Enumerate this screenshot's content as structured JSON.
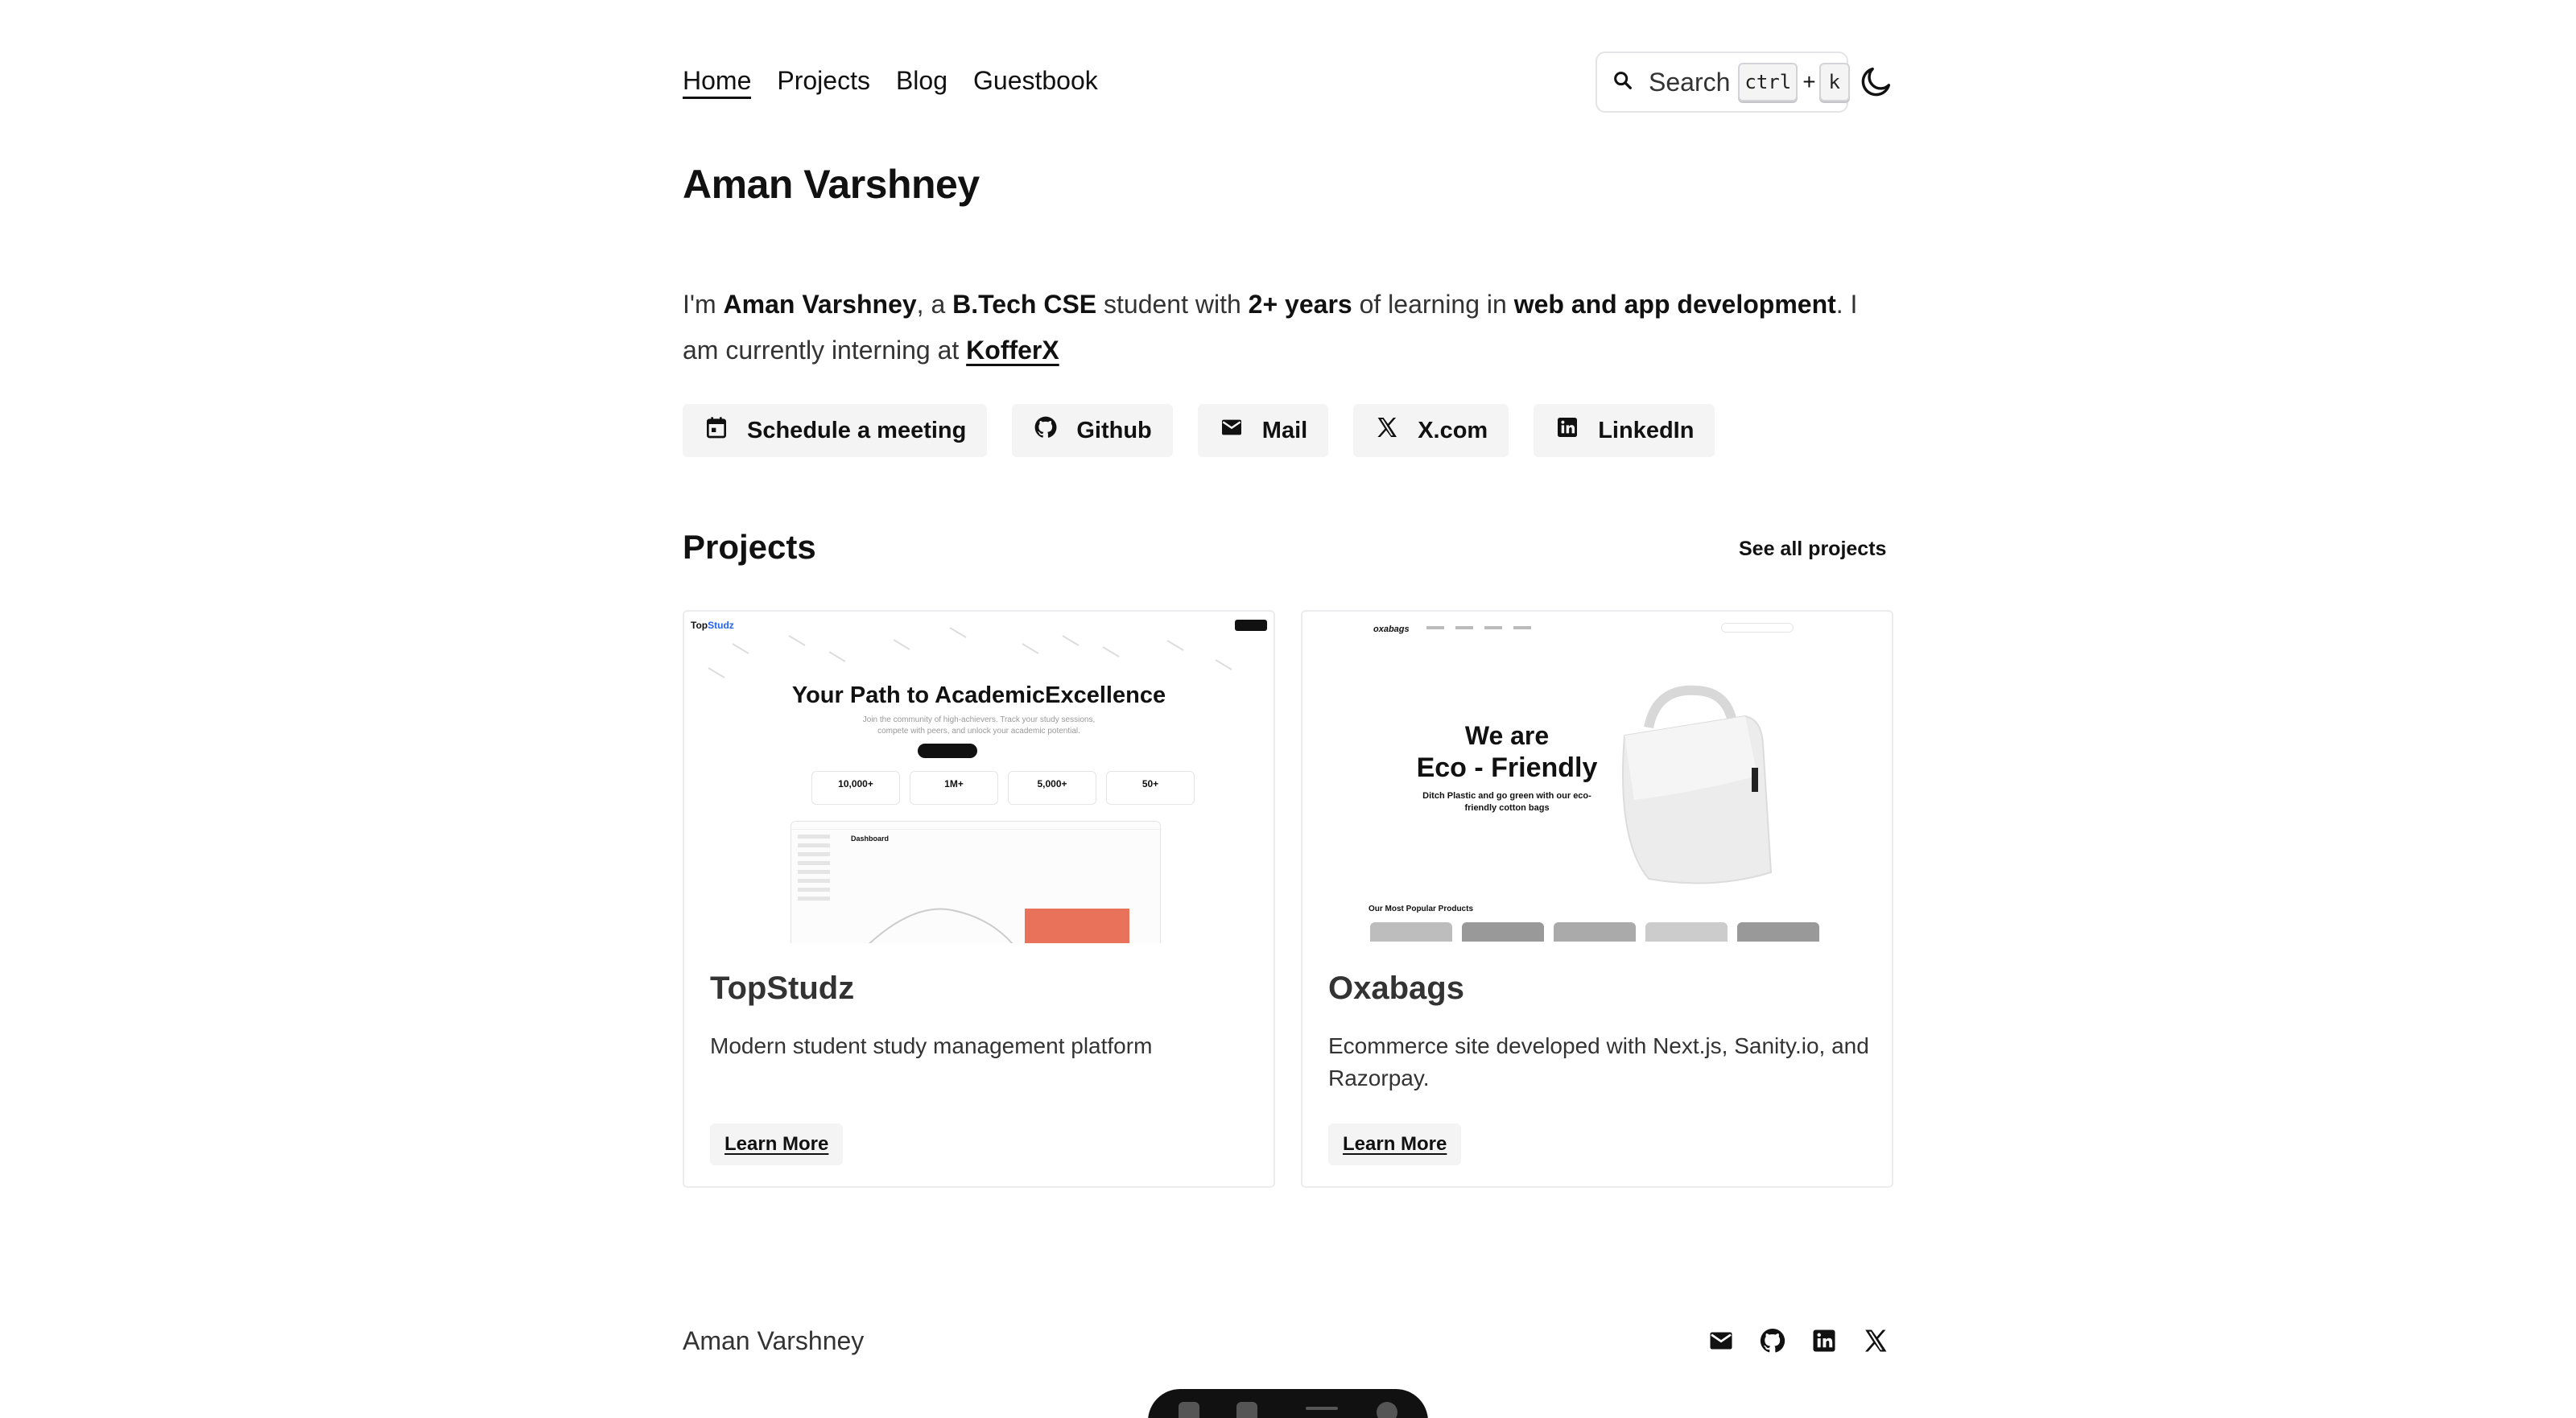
{
  "nav": {
    "links": [
      "Home",
      "Projects",
      "Blog",
      "Guestbook"
    ],
    "search_label": "Search",
    "shortcut_key1": "ctrl",
    "shortcut_plus": "+",
    "shortcut_key2": "k",
    "theme_icon": "moon-icon"
  },
  "hero": {
    "name": "Aman Varshney",
    "intro_1": "I'm ",
    "intro_name": "Aman Varshney",
    "intro_2": ", a ",
    "intro_degree": "B.Tech CSE",
    "intro_3": " student with ",
    "intro_years": "2+ years",
    "intro_4": " of learning in ",
    "intro_field": "web and app development",
    "intro_5": ". I am currently interning at ",
    "intro_company": "KofferX"
  },
  "socials": [
    {
      "label": "Schedule a meeting",
      "icon": "calendar-icon"
    },
    {
      "label": "Github",
      "icon": "github-icon"
    },
    {
      "label": "Mail",
      "icon": "mail-icon"
    },
    {
      "label": "X.com",
      "icon": "x-icon"
    },
    {
      "label": "LinkedIn",
      "icon": "linkedin-icon"
    }
  ],
  "projects": {
    "title": "Projects",
    "see_all": "See all projects",
    "items": [
      {
        "title": "TopStudz",
        "description": "Modern student study management platform",
        "cta": "Learn More",
        "preview": {
          "logo_a": "Top",
          "logo_b": "Studz",
          "headline": "Your Path to AcademicExcellence",
          "sub1": "Join the community of high-achievers. Track your study sessions,",
          "sub2": "compete with peers, and unlock your academic potential.",
          "stats": [
            "10,000+",
            "1M+",
            "5,000+",
            "50+"
          ],
          "dashboard_label": "Dashboard"
        }
      },
      {
        "title": "Oxabags",
        "description": "Ecommerce site developed with Next.js, Sanity.io, and Razorpay.",
        "cta": "Learn More",
        "preview": {
          "logo": "oxabags",
          "headline1": "We are",
          "headline2": "Eco - Friendly",
          "tagline": "Ditch Plastic and go green with our eco-friendly cotton bags",
          "section": "Our Most Popular Products"
        }
      }
    ]
  },
  "footer": {
    "name": "Aman Varshney",
    "icons": [
      "mail-icon",
      "github-icon",
      "linkedin-icon",
      "x-icon"
    ]
  }
}
